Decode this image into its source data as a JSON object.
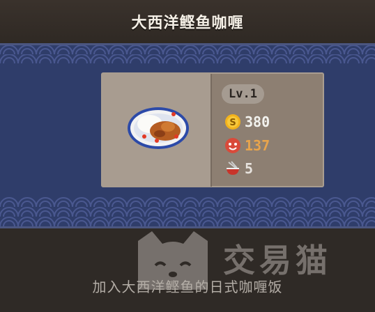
{
  "header": {
    "title": "大西洋鲣鱼咖喱"
  },
  "item": {
    "level": "Lv.1",
    "price": "380",
    "appeal": "137",
    "bowls": "5",
    "image_icon": "curry-dish-icon"
  },
  "icons": {
    "price": "coin-icon",
    "appeal": "appeal-face-icon",
    "bowls": "bowl-icon"
  },
  "colors": {
    "banner": "#2f3d6a",
    "price_text": "#f2f2ee",
    "appeal_text": "#e8a44c",
    "coin": "#f2b21b",
    "appeal_icon": "#d94a3a"
  },
  "footer": {
    "description": "加入大西洋鲣鱼的日式咖喱饭"
  },
  "watermark": {
    "text": "交易猫"
  }
}
